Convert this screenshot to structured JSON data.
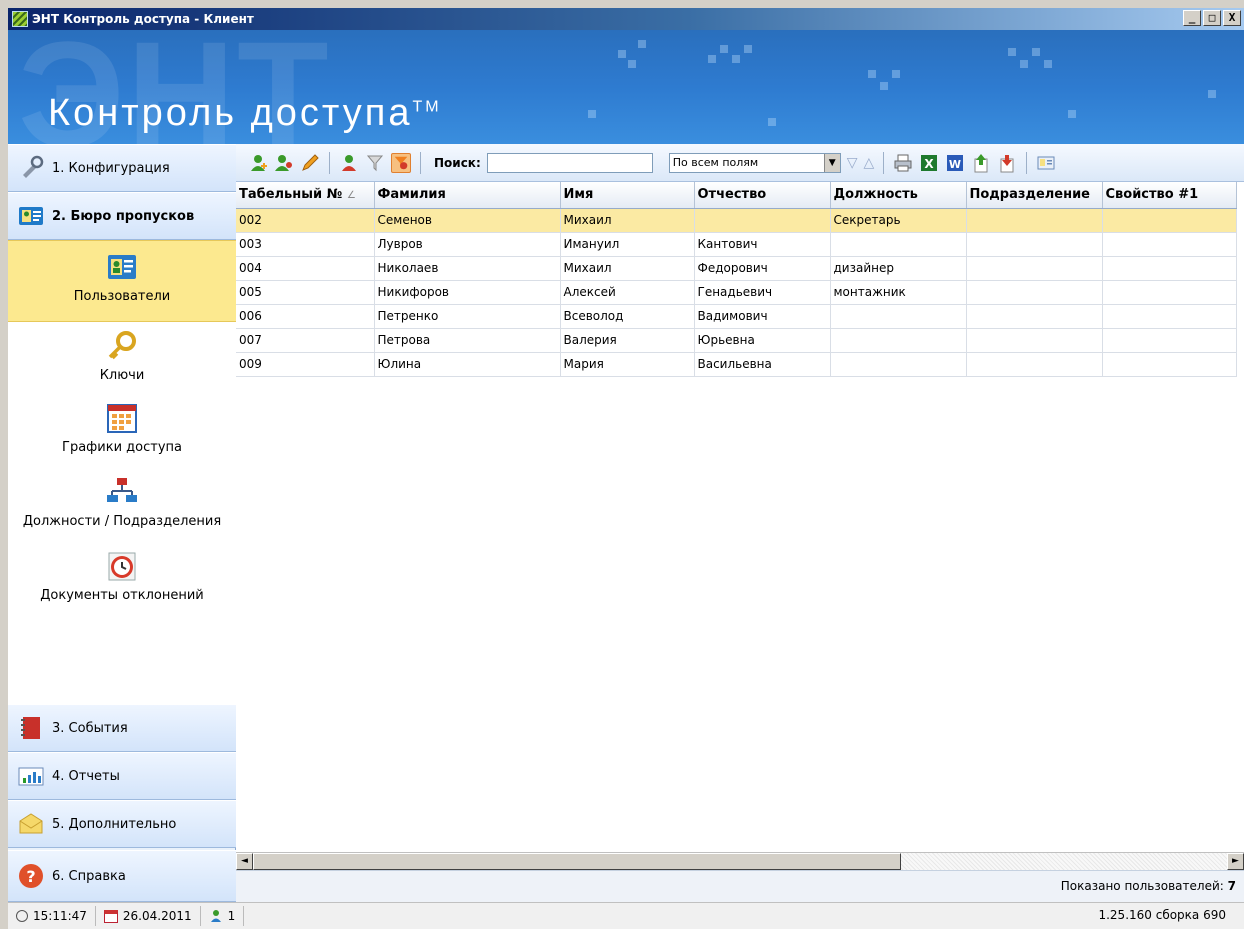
{
  "window": {
    "title": "ЭНТ Контроль доступа - Клиент",
    "min": "_",
    "max": "□",
    "close": "X"
  },
  "banner": {
    "bg_text": "ЭНТ",
    "brand": "Контроль доступа",
    "tm": "TM"
  },
  "nav": {
    "sections": [
      {
        "label": "1. Конфигурация",
        "icon": "wrench-icon"
      },
      {
        "label": "2. Бюро пропусков",
        "icon": "id-card-icon"
      },
      {
        "label": "3. События",
        "icon": "notebook-icon"
      },
      {
        "label": "4. Отчеты",
        "icon": "chart-icon"
      },
      {
        "label": "5. Дополнительно",
        "icon": "envelope-icon"
      },
      {
        "label": "6. Справка",
        "icon": "help-icon"
      }
    ],
    "items": [
      {
        "label": "Пользователи",
        "icon": "users-card-icon",
        "active": true
      },
      {
        "label": "Ключи",
        "icon": "key-icon",
        "active": false
      },
      {
        "label": "Графики доступа",
        "icon": "calendar-icon",
        "active": false
      },
      {
        "label": "Должности / Подразделения",
        "icon": "org-chart-icon",
        "active": false
      },
      {
        "label": "Документы отклонений",
        "icon": "alarm-clock-icon",
        "active": false
      }
    ]
  },
  "toolbar": {
    "search_label": "Поиск:",
    "search_value": "",
    "field_select": "По всем полям",
    "select_arrow": "▼",
    "filter_down": "▽",
    "filter_up": "△",
    "colors": {
      "user_green": "#3a9a2a",
      "user_red": "#d23a2a",
      "pencil": "#f0a020",
      "filter_active": "#f08020",
      "excel": "#1e7a2e",
      "word": "#2a5ab8"
    }
  },
  "grid": {
    "sort_marker": "∠",
    "columns": [
      "Табельный №",
      "Фамилия",
      "Имя",
      "Отчество",
      "Должность",
      "Подразделение",
      "Свойство #1"
    ],
    "rows": [
      [
        "002",
        "Семенов",
        "Михаил",
        "",
        "Секретарь",
        "",
        ""
      ],
      [
        "003",
        "Лувров",
        "Имануил",
        "Кантович",
        "",
        "",
        ""
      ],
      [
        "004",
        "Николаев",
        "Михаил",
        "Федорович",
        "дизайнер",
        "",
        ""
      ],
      [
        "005",
        "Никифоров",
        "Алексей",
        "Генадьевич",
        "монтажник",
        "",
        ""
      ],
      [
        "006",
        "Петренко",
        "Всеволод",
        "Вадимович",
        "",
        "",
        ""
      ],
      [
        "007",
        "Петрова",
        "Валерия",
        "Юрьевна",
        "",
        "",
        ""
      ],
      [
        "009",
        "Юлина",
        "Мария",
        "Васильевна",
        "",
        "",
        ""
      ]
    ],
    "selected_row": 0
  },
  "scroll": {
    "left": "◄",
    "right": "►"
  },
  "count": {
    "label": "Показано пользователей:",
    "value": "7"
  },
  "status": {
    "time": "15:11:47",
    "date": "26.04.2011",
    "users": "1",
    "version": "1.25.160 сборка 690"
  }
}
